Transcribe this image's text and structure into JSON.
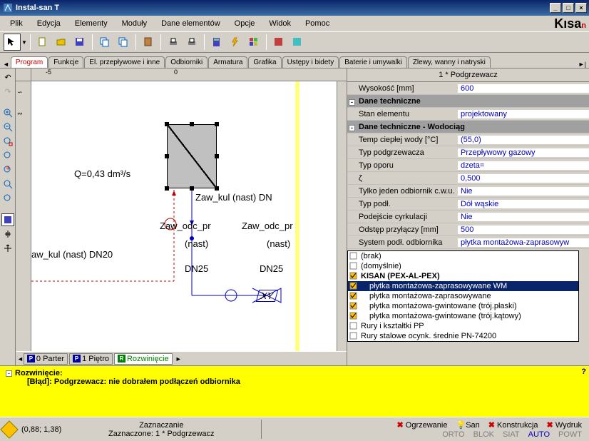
{
  "window": {
    "title": "Instal-san T"
  },
  "menu": [
    "Plik",
    "Edycja",
    "Elementy",
    "Moduły",
    "Dane elementów",
    "Opcje",
    "Widok",
    "Pomoc"
  ],
  "tabs": [
    "Program",
    "Funkcje",
    "El. przepływowe i inne",
    "Odbiorniki",
    "Armatura",
    "Grafika",
    "Ustępy i bidety",
    "Baterie i umywalki",
    "Zlewy, wanny i natryski"
  ],
  "canvas": {
    "q_label": "Q=0,43 dm³/s",
    "t1": "Zaw_kul (nast) DN",
    "t2a": "Zaw_odc_pr",
    "t2b": "Zaw_odc_pr",
    "t3a": "(nast)",
    "t3b": "(nast)",
    "t4": "aw_kul (nast) DN20",
    "t5a": "DN25",
    "t5b": "DN25",
    "xy": "XY"
  },
  "btabs": [
    {
      "ico": "P",
      "label": "0 Parter"
    },
    {
      "ico": "P",
      "label": "1 Piętro"
    },
    {
      "ico": "R",
      "label": "Rozwinięcie",
      "active": true
    }
  ],
  "props": {
    "title": "1 * Podgrzewacz",
    "rows": [
      {
        "label": "Wysokość [mm]",
        "val": "600"
      },
      {
        "label": "Dane techniczne",
        "section": true
      },
      {
        "label": "Stan elementu",
        "val": "projektowany"
      },
      {
        "label": "Dane techniczne - Wodociąg",
        "section": true
      },
      {
        "label": "Temp ciepłej wody [°C]",
        "val": "(55,0)"
      },
      {
        "label": "Typ podgrzewacza",
        "val": "Przepływowy gazowy"
      },
      {
        "label": "Typ oporu",
        "val": "dzeta="
      },
      {
        "label": "ζ",
        "val": "0,500"
      },
      {
        "label": "Tylko jeden odbiornik c.w.u.",
        "val": "Nie"
      },
      {
        "label": "Typ podł.",
        "val": "Dół wąskie"
      },
      {
        "label": "Podejście cyrkulacji",
        "val": "Nie"
      },
      {
        "label": "Odstęp przyłączy [mm]",
        "val": "500"
      },
      {
        "label": "System podł. odbiornika",
        "val": "płytka montażowa-zaprasowyw"
      }
    ],
    "dropdown": [
      {
        "label": "(brak)",
        "chk": false
      },
      {
        "label": "(domyślnie)",
        "chk": false
      },
      {
        "label": "KISAN (PEX-AL-PEX)",
        "chk": true,
        "bold": true
      },
      {
        "label": "płytka montażowa-zaprasowywane WM",
        "chk": true,
        "sel": true,
        "indent": true
      },
      {
        "label": "płytka montażowa-zaprasowywane",
        "chk": true,
        "indent": true
      },
      {
        "label": "płytka montażowa-gwintowane (trój.płaski)",
        "chk": true,
        "indent": true
      },
      {
        "label": "płytka montażowa-gwintowane (trój.kątowy)",
        "chk": true,
        "indent": true
      },
      {
        "label": "Rury i kształtki PP",
        "chk": false
      },
      {
        "label": "Rury stalowe ocynk. średnie PN-74200",
        "chk": false
      }
    ]
  },
  "messages": {
    "title": "Rozwinięcie:",
    "line": "[Błąd]:  Podgrzewacz: nie dobrałem podłączeń odbiornika"
  },
  "status": {
    "coords": "(0,88; 1,38)",
    "mid1": "Zaznaczanie",
    "mid2": "Zaznaczone: 1 * Podgrzewacz",
    "right_tabs": [
      "Ogrzewanie",
      "San",
      "Konstrukcja",
      "Wydruk"
    ],
    "mini": [
      "ORTO",
      "BLOK",
      "SIAT",
      "AUTO",
      "POWT"
    ]
  }
}
